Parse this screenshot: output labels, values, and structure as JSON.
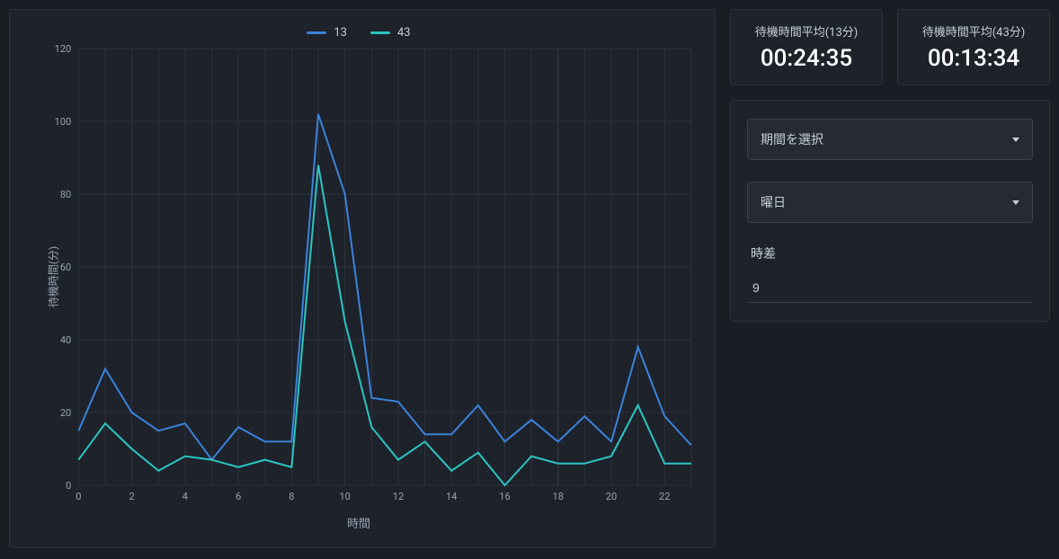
{
  "stats": [
    {
      "title": "待機時間平均(13分)",
      "value": "00:24:35"
    },
    {
      "title": "待機時間平均(43分)",
      "value": "00:13:34"
    }
  ],
  "controls": {
    "period_label": "期間を選択",
    "dow_label": "曜日",
    "offset_label": "時差",
    "offset_value": "9"
  },
  "chart_data": {
    "type": "line",
    "title": "",
    "xlabel": "時間",
    "ylabel": "待機時間(分)",
    "xlim": [
      0,
      23
    ],
    "ylim": [
      0,
      120
    ],
    "yticks": [
      0,
      20,
      40,
      60,
      80,
      100,
      120
    ],
    "xticks": [
      0,
      2,
      4,
      6,
      8,
      10,
      12,
      14,
      16,
      18,
      20,
      22
    ],
    "x": [
      0,
      1,
      2,
      3,
      4,
      5,
      6,
      7,
      8,
      9,
      10,
      11,
      12,
      13,
      14,
      15,
      16,
      17,
      18,
      19,
      20,
      21,
      22,
      23
    ],
    "series": [
      {
        "name": "13",
        "color": "#3b82d9",
        "values": [
          15,
          32,
          20,
          15,
          17,
          7,
          16,
          12,
          12,
          102,
          80,
          24,
          23,
          14,
          14,
          22,
          12,
          18,
          12,
          19,
          12,
          38,
          19,
          11
        ]
      },
      {
        "name": "43",
        "color": "#2bc5c0",
        "values": [
          7,
          17,
          10,
          4,
          8,
          7,
          5,
          7,
          5,
          88,
          45,
          16,
          7,
          12,
          4,
          9,
          0,
          8,
          6,
          6,
          8,
          22,
          6,
          6
        ]
      }
    ]
  }
}
